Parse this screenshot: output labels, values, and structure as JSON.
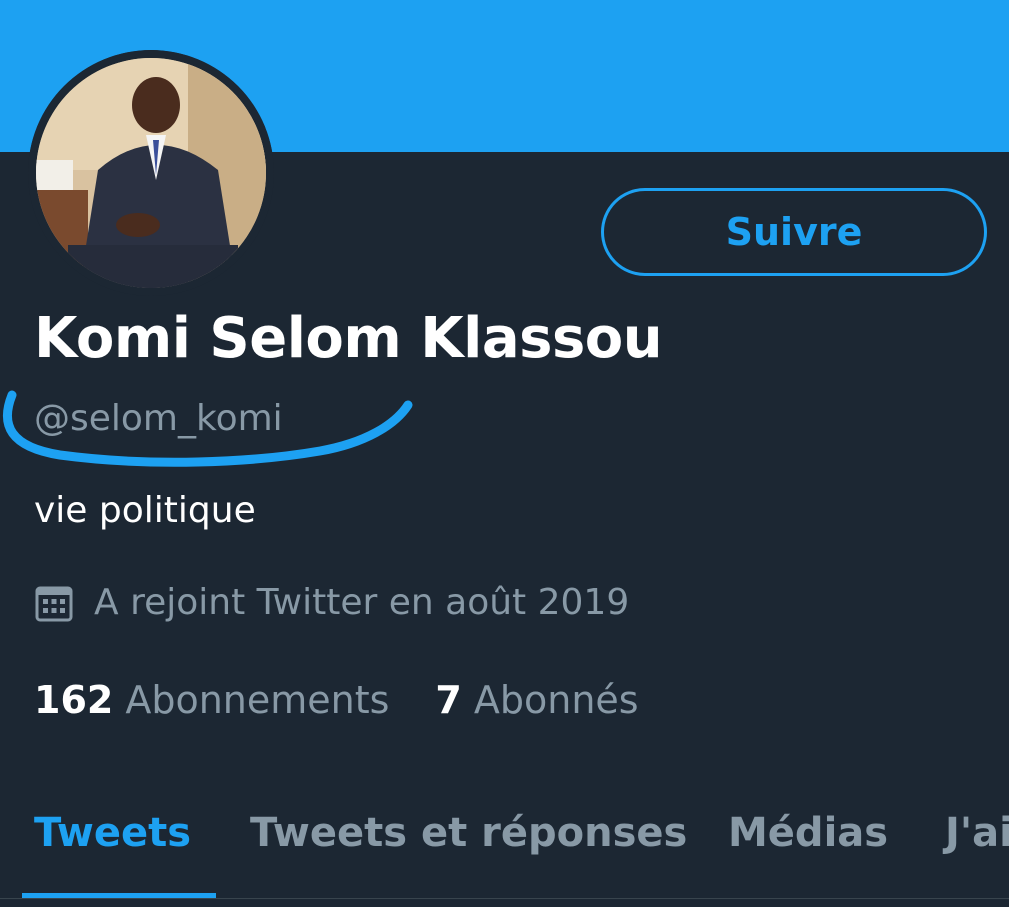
{
  "profile": {
    "display_name": "Komi Selom Klassou",
    "handle": "@selom_komi",
    "bio": "vie politique",
    "joined": "A rejoint Twitter en août 2019",
    "follow_label": "Suivre",
    "avatar_icon": "profile-photo"
  },
  "stats": {
    "following_count": "162",
    "following_label": "Abonnements",
    "followers_count": "7",
    "followers_label": "Abonnés"
  },
  "tabs": [
    {
      "label": "Tweets",
      "active": true
    },
    {
      "label": "Tweets et réponses",
      "active": false
    },
    {
      "label": "Médias",
      "active": false
    },
    {
      "label": "J'ai",
      "active": false
    }
  ],
  "colors": {
    "accent": "#1da1f2",
    "background": "#1c2733",
    "secondary_text": "#8899a6",
    "annotation": "#1da1f2"
  },
  "icons": {
    "joined": "calendar-icon"
  }
}
